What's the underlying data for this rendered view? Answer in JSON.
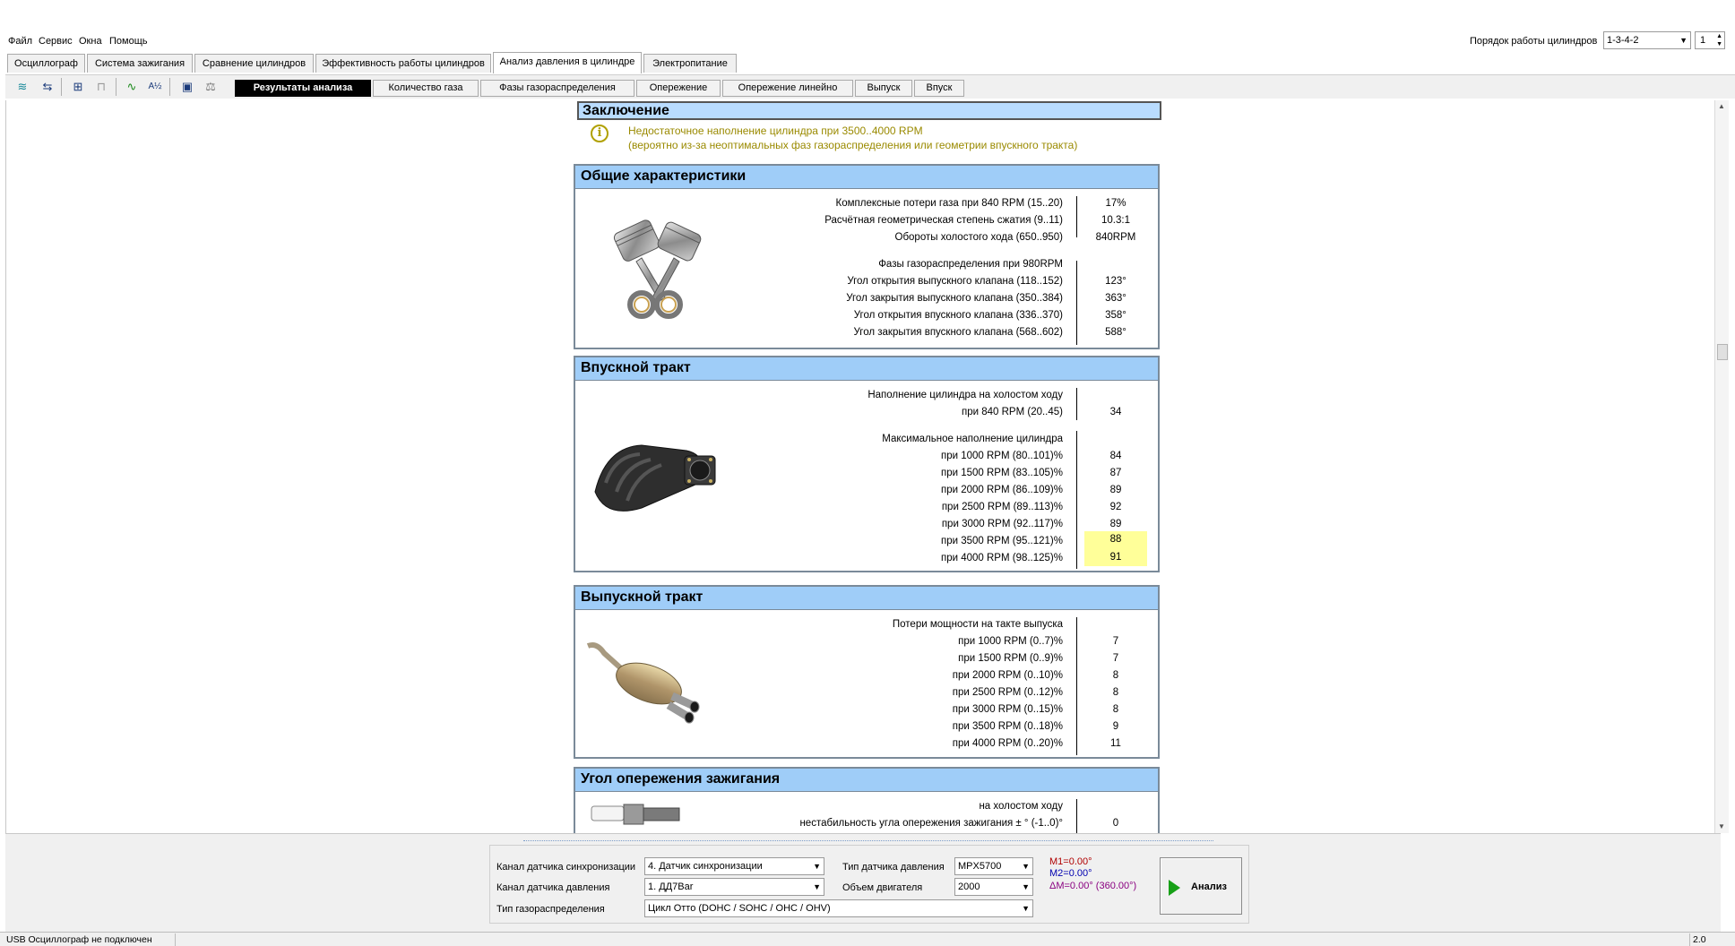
{
  "menu": [
    "Файл",
    "Сервис",
    "Окна",
    "Помощь"
  ],
  "cylinder_order": {
    "label": "Порядок работы цилиндров",
    "value": "1-3-4-2",
    "spin_value": "1"
  },
  "main_tabs": [
    "Осциллограф",
    "Система зажигания",
    "Сравнение цилиндров",
    "Эффективность работы цилиндров",
    "Анализ давления в цилиндре",
    "Электропитание"
  ],
  "sub_tabs": [
    "Результаты анализа",
    "Количество газа",
    "Фазы газораспределения",
    "Опережение",
    "Опережение линейно",
    "Выпуск",
    "Впуск"
  ],
  "toolbar_icons": [
    "scope-icon",
    "scale-icon",
    "auto-scale-icon",
    "scale-disabled-icon",
    "line-graph-icon",
    "algorithm-icon",
    "save-icon",
    "compare-icon"
  ],
  "conclusion": {
    "title": "Заключение",
    "line1": "Недостаточное наполнение цилиндра при 3500..4000 RPM",
    "line2": "(вероятно из-за неоптимальных фаз газораспределения или геометрии впускного тракта)"
  },
  "general": {
    "title": "Общие характеристики",
    "rows": [
      {
        "label": "Комплексные потери газа при 840 RPM (15..20)",
        "value": "17%"
      },
      {
        "label": "Расчётная геометрическая степень сжатия (9..11)",
        "value": "10.3:1"
      },
      {
        "label": "Обороты холостого хода (650..950)",
        "value": "840RPM"
      },
      {
        "label": "Фазы газораспределения при 980RPM",
        "value": ""
      },
      {
        "label": "Угол открытия выпускного клапана (118..152)",
        "value": "123°"
      },
      {
        "label": "Угол закрытия выпускного клапана (350..384)",
        "value": "363°"
      },
      {
        "label": "Угол открытия впускного клапана (336..370)",
        "value": "358°"
      },
      {
        "label": "Угол закрытия впускного клапана (568..602)",
        "value": "588°"
      }
    ]
  },
  "intake": {
    "title": "Впускной тракт",
    "rows": [
      {
        "label": "Наполнение цилиндра на холостом ходу",
        "value": ""
      },
      {
        "label": "при 840 RPM (20..45)",
        "value": "34"
      },
      {
        "label": "Максимальное наполнение цилиндра",
        "value": ""
      },
      {
        "label": "при  1000 RPM (80..101)%",
        "value": "84"
      },
      {
        "label": "при  1500 RPM (83..105)%",
        "value": "87"
      },
      {
        "label": "при  2000 RPM (86..109)%",
        "value": "89"
      },
      {
        "label": "при  2500 RPM (89..113)%",
        "value": "92"
      },
      {
        "label": "при  3000 RPM (92..117)%",
        "value": "89"
      },
      {
        "label": "при  3500 RPM (95..121)%",
        "value": "88"
      },
      {
        "label": "при  4000 RPM (98..125)%",
        "value": "91"
      }
    ]
  },
  "exhaust": {
    "title": "Выпускной тракт",
    "rows": [
      {
        "label": "Потери мощности на такте выпуска",
        "value": ""
      },
      {
        "label": "при  1000 RPM (0..7)%",
        "value": "7"
      },
      {
        "label": "при  1500 RPM (0..9)%",
        "value": "7"
      },
      {
        "label": "при  2000 RPM (0..10)%",
        "value": "8"
      },
      {
        "label": "при  2500 RPM (0..12)%",
        "value": "8"
      },
      {
        "label": "при  3000 RPM (0..15)%",
        "value": "8"
      },
      {
        "label": "при  3500 RPM (0..18)%",
        "value": "9"
      },
      {
        "label": "при  4000 RPM (0..20)%",
        "value": "11"
      }
    ]
  },
  "ignition": {
    "title": "Угол опережения зажигания",
    "rows": [
      {
        "label": "на холостом ходу",
        "value": ""
      },
      {
        "label": "нестабильность угла опережения зажигания ± ° (-1..0)°",
        "value": "0"
      }
    ]
  },
  "settings": {
    "sync_channel_label": "Канал датчика синхронизации",
    "sync_channel_value": "4.  Датчик синхронизации",
    "pressure_channel_label": "Канал датчика давления",
    "pressure_channel_value": "1.  ДД7Bar",
    "valve_type_label": "Тип газораспределения",
    "valve_type_value": "Цикл Отто (DOHC / SOHC / OHC / OHV)",
    "sensor_type_label": "Тип датчика давления",
    "sensor_type_value": "MPX5700",
    "engine_volume_label": "Объем двигателя",
    "engine_volume_value": "2000"
  },
  "markers": {
    "m1": "M1=0.00°",
    "m2": "M2=0.00°",
    "dm": "ΔM=0.00° (360.00°)"
  },
  "analyze_button": "Анализ",
  "status": {
    "connection": "USB Осциллограф не подключен",
    "version": "2.0"
  },
  "colors": {
    "section_header": "#9fcdf8",
    "conclusion_header": "#b9dcff",
    "highlight": "#ffff99",
    "conclusion_text": "#9a8a00"
  }
}
